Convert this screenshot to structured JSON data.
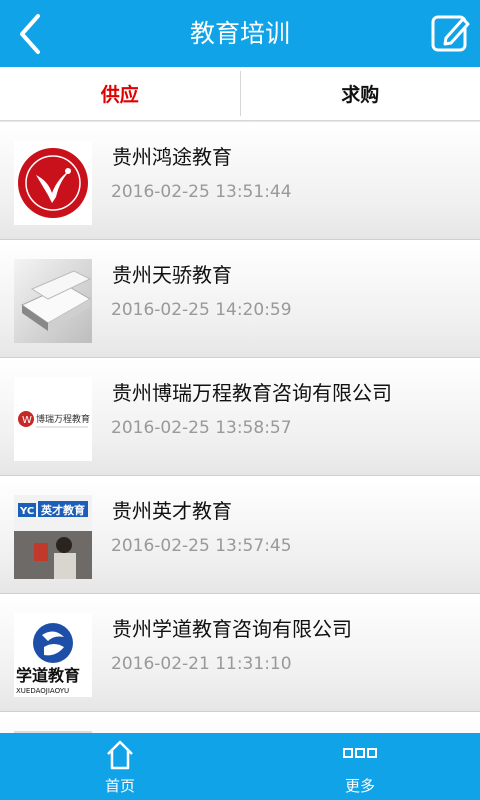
{
  "header": {
    "title": "教育培训",
    "back_icon": "chevron-left-icon",
    "edit_icon": "edit-icon"
  },
  "tabs": [
    {
      "label": "供应",
      "active": true
    },
    {
      "label": "求购",
      "active": false
    }
  ],
  "colors": {
    "header_bg": "#11a3e8",
    "active_tab": "#e00000"
  },
  "items": [
    {
      "name": "贵州鸿途教育",
      "date": "2016-02-25 13:51:44",
      "thumb_text": ""
    },
    {
      "name": "贵州天骄教育",
      "date": "2016-02-25 14:20:59",
      "thumb_text": ""
    },
    {
      "name": "贵州博瑞万程教育咨询有限公司",
      "date": "2016-02-25 13:58:57",
      "thumb_text": "博瑞万程教育"
    },
    {
      "name": "贵州英才教育",
      "date": "2016-02-25 13:57:45",
      "thumb_text": "英才教育"
    },
    {
      "name": "贵州学道教育咨询有限公司",
      "date": "2016-02-21 11:31:10",
      "thumb_text": "学道教育",
      "thumb_subtext": "XUEDAOJIAOYU"
    }
  ],
  "bottom_nav": [
    {
      "label": "首页",
      "icon": "home-icon"
    },
    {
      "label": "更多",
      "icon": "grid-icon"
    }
  ]
}
